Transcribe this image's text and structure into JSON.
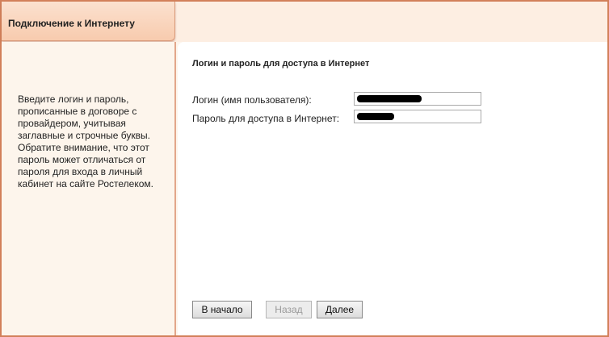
{
  "header": {
    "title": "Подключение к Интернету"
  },
  "help": {
    "text": "Введите логин и пароль, прописанные в договоре с провайдером, учитывая заглавные и строчные буквы. Обратите внимание, что этот пароль может отличаться от пароля для входа в личный кабинет на сайте Ростелеком."
  },
  "form": {
    "section_title": "Логин и пароль для доступа в Интернет",
    "login_label": "Логин (имя пользователя):",
    "password_label": "Пароль для доступа в Интернет:"
  },
  "buttons": {
    "start": "В начало",
    "back": "Назад",
    "next": "Далее"
  }
}
